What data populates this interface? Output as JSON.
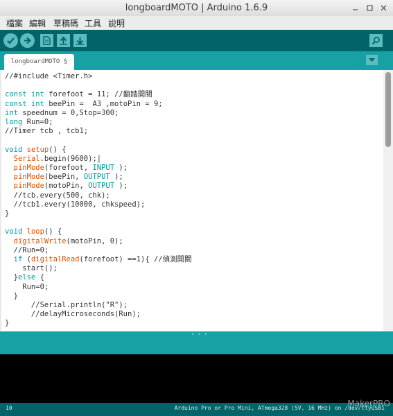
{
  "window": {
    "title": "longboardMOTO | Arduino 1.6.9"
  },
  "menu": [
    "檔案",
    "編輯",
    "草稿碼",
    "工具",
    "說明"
  ],
  "tab": {
    "label": "longboardMOTO §"
  },
  "code": {
    "lines": [
      [
        [
          "",
          "//#include <Timer.h>"
        ]
      ],
      [],
      [
        [
          "kw",
          "const int"
        ],
        [
          "",
          "forefoot = 11; //翻踏開關"
        ]
      ],
      [
        [
          "kw",
          "const int"
        ],
        [
          "",
          "beePin =  A3 ,motoPin = 9;"
        ]
      ],
      [
        [
          "kw",
          "int"
        ],
        [
          "",
          "speednum = 0,Stop=300;"
        ]
      ],
      [
        [
          "kw",
          "long"
        ],
        [
          "",
          "Run=0;"
        ]
      ],
      [
        [
          "",
          "//Timer tcb , tcb1;"
        ]
      ],
      [],
      [
        [
          "kw",
          "void"
        ],
        [
          "fn",
          "setup"
        ],
        [
          "",
          "() {"
        ]
      ],
      [
        [
          "",
          "  "
        ],
        [
          "fn",
          "Serial"
        ],
        [
          "",
          ".begin(9600);|"
        ]
      ],
      [
        [
          "",
          "  "
        ],
        [
          "fn",
          "pinMode"
        ],
        [
          "",
          "(forefoot, "
        ],
        [
          "kw",
          "INPUT"
        ],
        [
          "",
          ");"
        ]
      ],
      [
        [
          "",
          "  "
        ],
        [
          "fn",
          "pinMode"
        ],
        [
          "",
          "(beePin, "
        ],
        [
          "kw",
          "OUTPUT"
        ],
        [
          "",
          ");"
        ]
      ],
      [
        [
          "",
          "  "
        ],
        [
          "fn",
          "pinMode"
        ],
        [
          "",
          "(motoPin, "
        ],
        [
          "kw",
          "OUTPUT"
        ],
        [
          "",
          ");"
        ]
      ],
      [
        [
          "",
          "  //tcb.every(500, chk);"
        ]
      ],
      [
        [
          "",
          "  //tcb1.every(10000, chkspeed);"
        ]
      ],
      [
        [
          "",
          "}"
        ]
      ],
      [],
      [
        [
          "kw",
          "void"
        ],
        [
          "fn",
          "loop"
        ],
        [
          "",
          "() {"
        ]
      ],
      [
        [
          "",
          "  "
        ],
        [
          "fn",
          "digitalWrite"
        ],
        [
          "",
          "(motoPin, 0);"
        ]
      ],
      [
        [
          "",
          "  //Run=0;"
        ]
      ],
      [
        [
          "",
          "  "
        ],
        [
          "kw",
          "if"
        ],
        [
          "",
          " ("
        ],
        [
          "fn",
          "digitalRead"
        ],
        [
          "",
          "(forefoot) ==1){ //偵測開關"
        ]
      ],
      [
        [
          "",
          "    start();"
        ]
      ],
      [
        [
          "",
          "  }"
        ],
        [
          "kw",
          "else"
        ],
        [
          "",
          "{"
        ]
      ],
      [
        [
          "",
          "    Run=0;"
        ]
      ],
      [
        [
          "",
          "  }"
        ]
      ],
      [
        [
          "",
          "      //Serial.println(\"R\");"
        ]
      ],
      [
        [
          "",
          "      //delayMicroseconds(Run);"
        ]
      ],
      [
        [
          "",
          "}"
        ]
      ]
    ]
  },
  "status": {
    "line_number": "10",
    "board": "Arduino Pro or Pro Mini, ATmega328 (5V, 16 MHz) on /dev/ttyUSB1"
  },
  "watermark": "MakerPRO",
  "icons": {
    "verify": "check-icon",
    "upload": "arrow-right-icon",
    "new": "new-file-icon",
    "open": "arrow-up-icon",
    "save": "arrow-down-icon",
    "serial_monitor": "magnifier-icon",
    "tab_menu": "triangle-down-icon"
  },
  "colors": {
    "toolbar": "#006468",
    "tabstrip": "#17a1a5",
    "button": "#5cbdc0",
    "keyword": "#00979c",
    "function": "#d35400"
  }
}
